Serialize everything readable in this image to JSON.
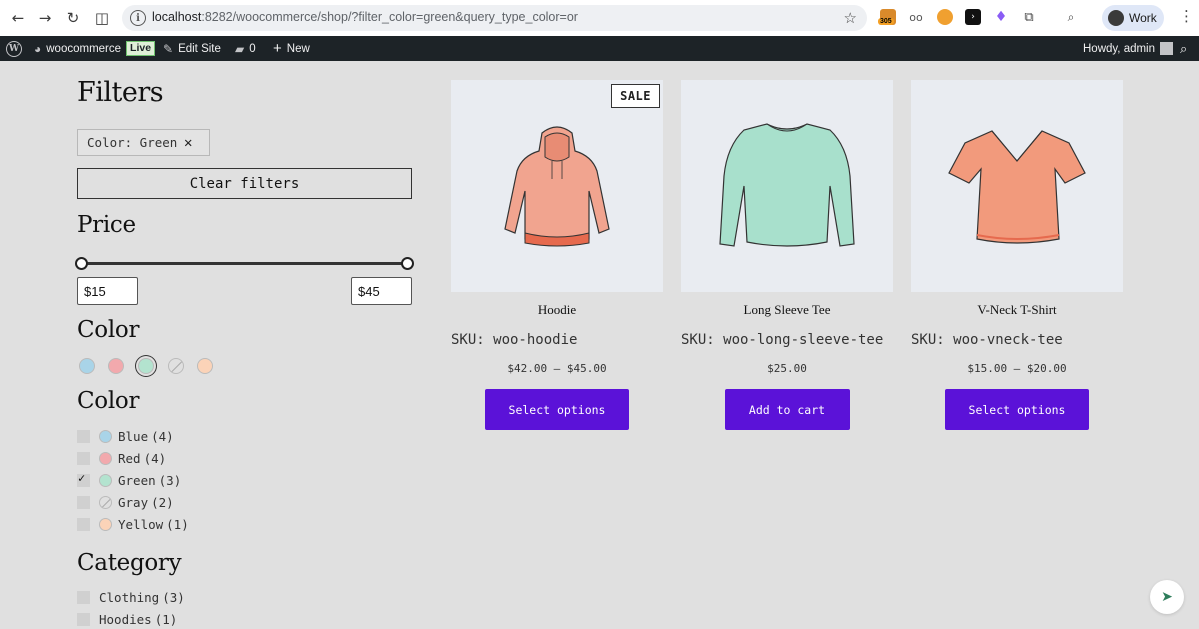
{
  "browser": {
    "url_host": "localhost",
    "url_path": ":8282/woocommerce/shop/?filter_color=green&query_type_color=or",
    "extension_badge": "305",
    "profile_label": "Work"
  },
  "adminbar": {
    "site_name": "woocommerce",
    "live_label": "Live",
    "edit_site": "Edit Site",
    "comments_count": "0",
    "new_label": "New",
    "howdy": "Howdy, admin"
  },
  "filters": {
    "heading": "Filters",
    "active_chip": "Color: Green",
    "clear_label": "Clear filters",
    "price_heading": "Price",
    "price_min": "$15",
    "price_max": "$45",
    "color_heading_swatches": "Color",
    "swatch_colors": [
      "#a9d4e8",
      "#f2a9ad",
      "#b3e3cf",
      "gray",
      "#fbd3b8"
    ],
    "color_heading_list": "Color",
    "colors": [
      {
        "label": "Blue",
        "count": "(4)",
        "hex": "#a9d4e8",
        "checked": false
      },
      {
        "label": "Red",
        "count": "(4)",
        "hex": "#f2a9ad",
        "checked": false
      },
      {
        "label": "Green",
        "count": "(3)",
        "hex": "#b3e3cf",
        "checked": true
      },
      {
        "label": "Gray",
        "count": "(2)",
        "hex": "gray",
        "checked": false
      },
      {
        "label": "Yellow",
        "count": "(1)",
        "hex": "#fbd3b8",
        "checked": false
      }
    ],
    "category_heading": "Category",
    "categories": [
      {
        "label": "Clothing",
        "count": "(3)"
      },
      {
        "label": "Hoodies",
        "count": "(1)"
      }
    ]
  },
  "products": [
    {
      "title": "Hoodie",
      "sku": "SKU: woo-hoodie",
      "price": "$42.00 – $45.00",
      "button": "Select options",
      "sale": "SALE"
    },
    {
      "title": "Long Sleeve Tee",
      "sku": "SKU: woo-long-sleeve-tee",
      "price": "$25.00",
      "button": "Add to cart",
      "sale": ""
    },
    {
      "title": "V-Neck T-Shirt",
      "sku": "SKU: woo-vneck-tee",
      "price": "$15.00 – $20.00",
      "button": "Select options",
      "sale": ""
    }
  ],
  "colors": {
    "accent_button": "#5b12d8",
    "adminbar_bg": "#1d2327",
    "page_bg": "#e0e0e0"
  }
}
